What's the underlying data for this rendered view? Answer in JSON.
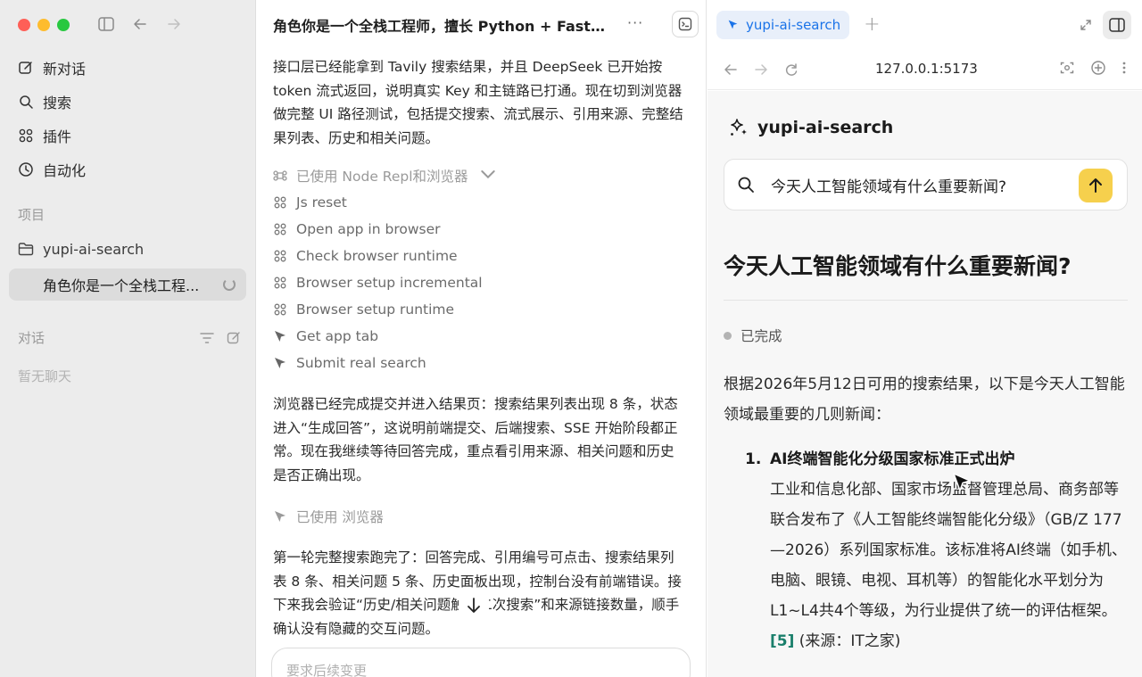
{
  "sidebar": {
    "nav": [
      {
        "label": "新对话",
        "icon": "edit-icon"
      },
      {
        "label": "搜索",
        "icon": "search-icon"
      },
      {
        "label": "插件",
        "icon": "grid-icon"
      },
      {
        "label": "自动化",
        "icon": "clock-icon"
      }
    ],
    "projects_label": "项目",
    "project_name": "yupi-ai-search",
    "thread_title": "角色你是一个全栈工程...",
    "conversations_label": "对话",
    "empty_text": "暂无聊天"
  },
  "chat": {
    "title": "角色你是一个全栈工程师，擅长 Python + FastA...",
    "paragraphs": [
      "接口层已经能拿到 Tavily 搜索结果，并且 DeepSeek 已开始按 token 流式返回，说明真实 Key 和主链路已打通。现在切到浏览器做完整 UI 路径测试，包括提交搜索、流式展示、引用来源、完整结果列表、历史和相关问题。",
      "浏览器已经完成提交并进入结果页：搜索结果列表出现 8 条，状态进入“生成回答”，这说明前端提交、后端搜索、SSE 开始阶段都正常。现在我继续等待回答完成，重点看引用来源、相关问题和历史是否正确出现。",
      "第一轮完整搜索跑完了：回答完成、引用编号可点击、搜索结果列表 8 条、相关问题 5 条、历史面板出现，控制台没有前端错误。接下来我会验证“历史/相关问题触发二次搜索”和来源链接数量，顺手确认没有隐藏的交互问题。"
    ],
    "tool_group_header": "已使用 Node Repl和浏览器",
    "tools": [
      {
        "label": "Js reset",
        "icon": "node-icon"
      },
      {
        "label": "Open app in browser",
        "icon": "node-icon"
      },
      {
        "label": "Check browser runtime",
        "icon": "node-icon"
      },
      {
        "label": "Browser setup incremental",
        "icon": "node-icon"
      },
      {
        "label": "Browser setup runtime",
        "icon": "node-icon"
      },
      {
        "label": "Get app tab",
        "icon": "pointer-icon"
      },
      {
        "label": "Submit real search",
        "icon": "pointer-icon"
      }
    ],
    "browser_used_label": "已使用 浏览器",
    "composer_placeholder": "要求后续变更"
  },
  "browser": {
    "tab_label": "yupi-ai-search",
    "url": "127.0.0.1:5173",
    "brand": "yupi-ai-search",
    "search_query": "今天人工智能领域有什么重要新闻?",
    "question": "今天人工智能领域有什么重要新闻?",
    "status": "已完成",
    "intro": "根据2026年5月12日可用的搜索结果，以下是今天人工智能领域最重要的几则新闻：",
    "news": [
      {
        "num": "1.",
        "title": "AI终端智能化分级国家标准正式出炉",
        "body": "工业和信息化部、国家市场监督管理总局、商务部等联合发布了《人工智能终端智能化分级》（GB/Z 177—2026）系列国家标准。该标准将AI终端（如手机、电脑、眼镜、电视、耳机等）的智能化水平划分为L1~L4共4个等级，为行业提供了统一的评估框架。",
        "cite": "[5]",
        "source": "(来源：IT之家)"
      }
    ],
    "accent_color": "#f6d04d",
    "cite_color": "#1a7f6b"
  }
}
